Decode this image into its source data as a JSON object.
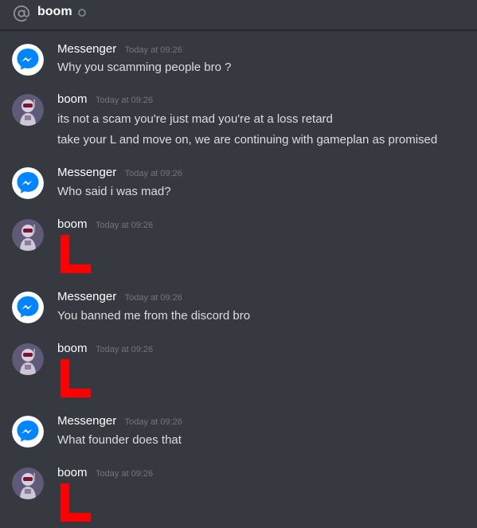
{
  "header": {
    "channel": "boom",
    "at_icon": "at-sign-icon",
    "status_icon": "offline-status-icon"
  },
  "colors": {
    "background": "#36393f",
    "messenger_blue": "#0084ff",
    "author": "#ffffff",
    "text": "#dcddde",
    "timestamp": "#72767d",
    "L_red": "#ff0000"
  },
  "messages": [
    {
      "author": "Messenger",
      "time": "Today at 09:26",
      "lines": [
        "Why you scamming people bro ?"
      ]
    },
    {
      "author": "boom",
      "time": "Today at 09:26",
      "lines": [
        "its not a scam you're just mad you're at a loss retard",
        "take your L and move on, we are continuing with gameplan as promised"
      ]
    },
    {
      "author": "Messenger",
      "time": "Today at 09:26",
      "lines": [
        "Who said i was mad?"
      ]
    },
    {
      "author": "boom",
      "time": "Today at 09:26",
      "image": "big-red-L"
    },
    {
      "author": "Messenger",
      "time": "Today at 09:26",
      "lines": [
        "You banned me from the discord bro"
      ]
    },
    {
      "author": "boom",
      "time": "Today at 09:26",
      "image": "big-red-L"
    },
    {
      "author": "Messenger",
      "time": "Today at 09:26",
      "lines": [
        "What founder does that"
      ]
    },
    {
      "author": "boom",
      "time": "Today at 09:26",
      "image": "big-red-L"
    }
  ]
}
